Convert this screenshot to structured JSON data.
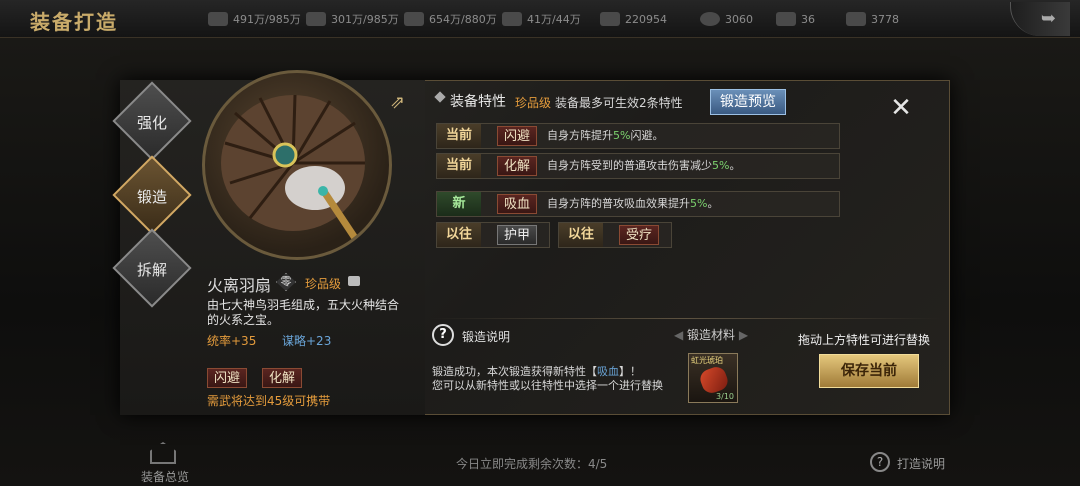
{
  "header": {
    "title": "装备打造",
    "resources": [
      {
        "icon": "silver-coin-icon",
        "value": "491万/985万"
      },
      {
        "icon": "wood-icon",
        "value": "301万/985万"
      },
      {
        "icon": "grain-icon",
        "value": "654万/880万"
      },
      {
        "icon": "iron-ore-icon",
        "value": "41万/44万"
      },
      {
        "icon": "merit-icon",
        "value": "220954"
      },
      {
        "icon": "copper-coin-icon",
        "value": "3060"
      },
      {
        "icon": "gold-ingot-icon",
        "value": "36"
      },
      {
        "icon": "jade-icon",
        "value": "3778"
      }
    ]
  },
  "side_tabs": [
    {
      "label": "强化",
      "active": false
    },
    {
      "label": "锻造",
      "active": true
    },
    {
      "label": "拆解",
      "active": false
    }
  ],
  "item": {
    "name": "火离羽扇",
    "grade_icon": "零",
    "quality": "珍品级",
    "description": "由七大神鸟羽毛组成，五大火种结合的火系之宝。",
    "stats": [
      "统率+35",
      "谋略+23"
    ],
    "traits": [
      "闪避",
      "化解"
    ],
    "requirement": "需武将达到45级可携带"
  },
  "traits_panel": {
    "title": "装备特性",
    "quality": "珍品级",
    "note": "装备最多可生效2条特性",
    "preview_button": "锻造预览",
    "current": [
      {
        "badge": "当前",
        "name": "闪避",
        "desc_pre": "自身方阵提升",
        "value": "5%",
        "desc_post": "闪避。"
      },
      {
        "badge": "当前",
        "name": "化解",
        "desc_pre": "自身方阵受到的普通攻击伤害减少",
        "value": "5%",
        "desc_post": "。"
      }
    ],
    "new": {
      "badge": "新",
      "name": "吸血",
      "desc_pre": "自身方阵的普攻吸血效果提升",
      "value": "5%",
      "desc_post": "。"
    },
    "previous": [
      {
        "badge": "以往",
        "name": "护甲"
      },
      {
        "badge": "以往",
        "name": "受疗"
      }
    ]
  },
  "forge_info": {
    "help_label": "锻造说明",
    "result_pre": "锻造成功，本次锻造获得新特性【",
    "result_trait": "吸血",
    "result_post": "】！",
    "result_line2": "您可以从新特性或以往特性中选择一个进行替换",
    "materials_label": "锻造材料",
    "material_name": "虹光琥珀",
    "material_count": "3/10",
    "drag_hint": "拖动上方特性可进行替换",
    "save_button": "保存当前"
  },
  "footer": {
    "overview_label": "装备总览",
    "remaining": "今日立即完成剩余次数：4/5",
    "help_label": "打造说明"
  }
}
